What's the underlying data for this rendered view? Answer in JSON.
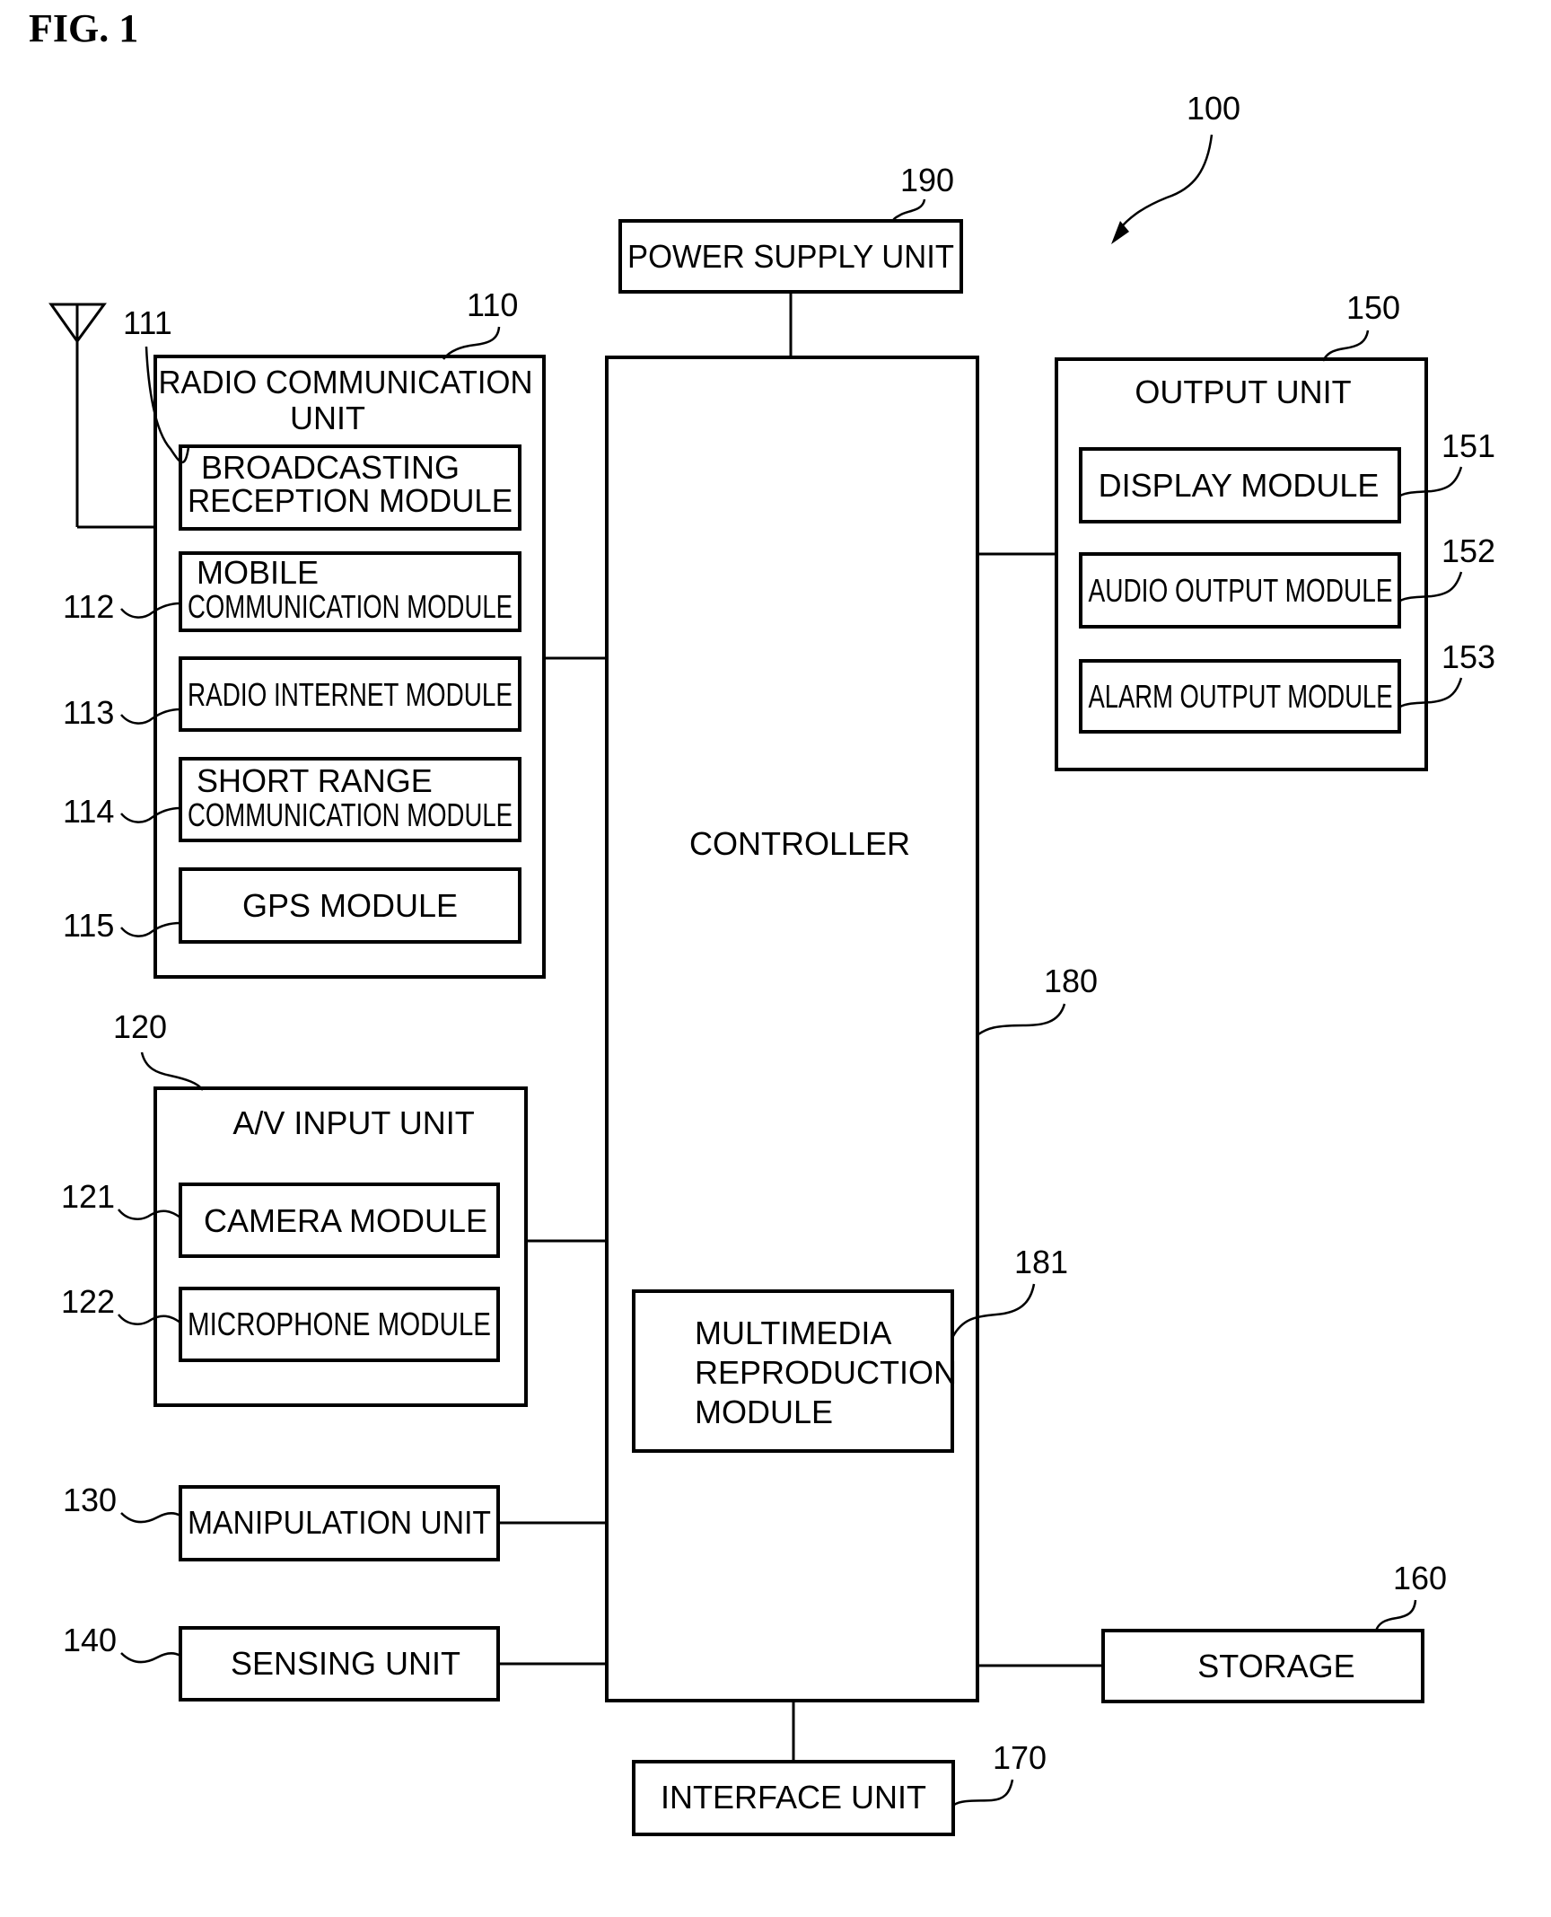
{
  "figure": {
    "title": "FIG. 1",
    "device_ref": "100"
  },
  "blocks": {
    "power_supply": {
      "ref": "190",
      "label": [
        "POWER SUPPLY UNIT"
      ]
    },
    "controller": {
      "ref": "180",
      "label": [
        "CONTROLLER"
      ]
    },
    "multimedia": {
      "ref": "181",
      "label": [
        "MULTIMEDIA",
        "REPRODUCTION",
        "MODULE"
      ]
    },
    "radio_comm": {
      "ref": "110",
      "label": [
        "RADIO COMMUNICATION",
        "UNIT"
      ]
    },
    "broadcasting": {
      "ref": "111",
      "label": [
        "BROADCASTING",
        "RECEPTION MODULE"
      ]
    },
    "mobile_comm": {
      "ref": "112",
      "label": [
        "MOBILE",
        "COMMUNICATION MODULE"
      ]
    },
    "radio_internet": {
      "ref": "113",
      "label": [
        "RADIO INTERNET MODULE"
      ]
    },
    "short_range": {
      "ref": "114",
      "label": [
        "SHORT RANGE",
        "COMMUNICATION MODULE"
      ]
    },
    "gps": {
      "ref": "115",
      "label": [
        "GPS MODULE"
      ]
    },
    "av_input": {
      "ref": "120",
      "label": [
        "A/V INPUT UNIT"
      ]
    },
    "camera": {
      "ref": "121",
      "label": [
        "CAMERA MODULE"
      ]
    },
    "microphone": {
      "ref": "122",
      "label": [
        "MICROPHONE MODULE"
      ]
    },
    "manipulation": {
      "ref": "130",
      "label": [
        "MANIPULATION UNIT"
      ]
    },
    "sensing": {
      "ref": "140",
      "label": [
        "SENSING UNIT"
      ]
    },
    "output": {
      "ref": "150",
      "label": [
        "OUTPUT UNIT"
      ]
    },
    "display": {
      "ref": "151",
      "label": [
        "DISPLAY MODULE"
      ]
    },
    "audio_out": {
      "ref": "152",
      "label": [
        "AUDIO OUTPUT MODULE"
      ]
    },
    "alarm_out": {
      "ref": "153",
      "label": [
        "ALARM OUTPUT MODULE"
      ]
    },
    "storage": {
      "ref": "160",
      "label": [
        "STORAGE"
      ]
    },
    "interface": {
      "ref": "170",
      "label": [
        "INTERFACE UNIT"
      ]
    }
  }
}
